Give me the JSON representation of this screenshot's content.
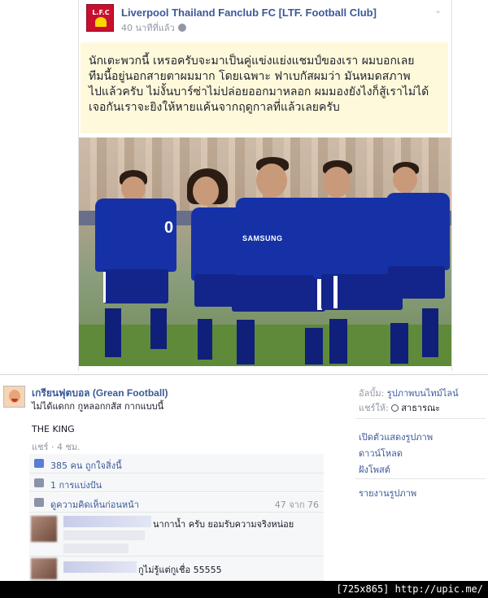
{
  "post": {
    "page_name": "Liverpool Thailand Fanclub FC [LTF. Football Club]",
    "time": "40 นาทีที่แล้ว",
    "caption_lines": [
      "นักเตะพวกนี้ เหรอครับจะมาเป็นคู่แข่งแย่งแชมป์ของเรา ผมบอกเลย",
      "ทีมนี้อยู่นอกสายตาผมมาก โดยเฉพาะ ฟาเบกัสผมว่า มันหมดสภาพ",
      "ไปแล้วครับ ไม่งั้นบาร์ซ่าไม่ปล่อยออกมาหลอก ผมมองยังไงก็สู้เราไม่ได้",
      "เจอกันเราจะยิงให้หายแค้นจากฤดูกาลที่แล้วเลยครับ"
    ],
    "photo": {
      "sponsor_text": "SAMSUNG",
      "shirt_number": "0"
    }
  },
  "share": {
    "author": "เกรียนฟุตบอล (Grean Football)",
    "author_sub": "ไม่ได้แดกก กูหลอกกสัส กากแบบนี้",
    "status": "THE KING",
    "meta": "แชร์ · 4 ชม.",
    "likes": "385 คน ถูกใจสิ่งนี้",
    "shares": "1 การแบ่งปัน",
    "view_more": "ดูความคิดเห็นก่อนหน้า",
    "comment_count": "47 จาก 76",
    "comments": [
      {
        "text": "นากาน้ำ ครับ ยอมรับความจริงหน่อย"
      },
      {
        "text": "กูไม่รู้แต่กูเชื่อ 55555"
      }
    ]
  },
  "sidebar": {
    "album_key": "อัลบั้ม:",
    "album_value": "รูปภาพบนไทม์ไลน์",
    "share_key": "แชร์ให้:",
    "share_value": "สาธารณะ",
    "links": [
      "เปิดตัวแสดงรูปภาพ",
      "ดาวน์โหลด",
      "ฝังโพสต์"
    ],
    "report": "รายงานรูปภาพ"
  },
  "watermark": "[725x865] http://upic.me/",
  "colors": {
    "link": "#3b5998",
    "kit_blue": "#1631a6",
    "caption_bg": "#fff9dc"
  }
}
